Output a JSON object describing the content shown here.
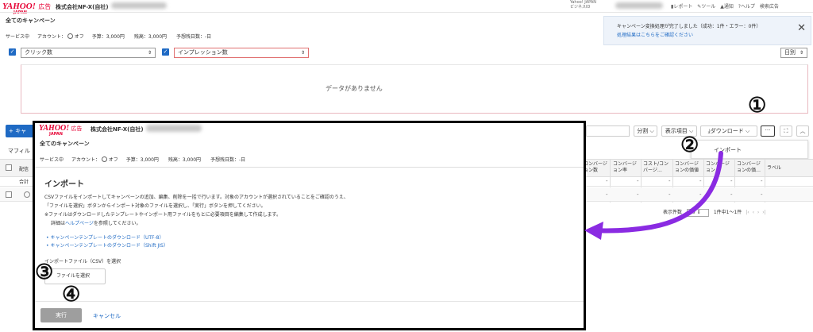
{
  "bg": {
    "logo_main": "YAHOO!",
    "logo_sub": "JAPAN",
    "logo_ad": "広告",
    "company": "株式会社NF-X(自社)",
    "yahoo_id_line1": "Yahoo! JAPAN",
    "yahoo_id_line2": "ビジネスID",
    "header_links": [
      "レポート",
      "ツール",
      "通知",
      "ヘルプ",
      "検索広告"
    ],
    "page_title": "全てのキャンペーン",
    "status_line": {
      "service": "サービス中",
      "account_label": "アカウント：",
      "account_value": "オフ",
      "budget": "予算：3,000円",
      "balance": "残高：3,000円",
      "days": "予想残日数：-日"
    },
    "notification": {
      "line1": "キャンペーン変換処理が完了しました（成功：1件・エラー：0件）",
      "line2": "処理結果はこちらをご確認ください"
    },
    "metric_select_1": "クリック数",
    "metric_select_2": "インプレッション数",
    "period_select": "日別",
    "no_data": "データがありません",
    "toolbar": {
      "add_button": "+ キャ",
      "split": "分割",
      "display_items": "表示項目",
      "download": "ダウンロード",
      "more": "···"
    },
    "menu_import": "インポート",
    "filter_label": "マフィル",
    "columns": [
      "コンバージョン数",
      "コンバージョン率",
      "コスト/コンバージ…",
      "コンバージョンの価値",
      "コンバージョン…",
      "コンバージョンの価…",
      "ラベル"
    ],
    "row_total_label": "合計",
    "row_setting_label": "配信",
    "dash": "-",
    "pagination": {
      "display_count_label": "表示件数",
      "display_count_value": "20",
      "range": "1件中1～1件"
    }
  },
  "dialog": {
    "logo_main": "YAHOO!",
    "logo_sub": "JAPAN",
    "logo_ad": "広告",
    "company": "株式会社NF-X(自社)",
    "page_title": "全てのキャンペーン",
    "status_line": {
      "service": "サービス中",
      "account_label": "アカウント：",
      "account_value": "オフ",
      "budget": "予算：3,000円",
      "balance": "残高：3,000円",
      "days": "予想残日数：-日"
    },
    "heading": "インポート",
    "desc_line1": "CSVファイルをインポートしてキャンペーンの追加、編集、削除を一括で行います。対象のアカウントが選択されていることをご確認のうえ、",
    "desc_line2": "「ファイルを選択」ボタンからインポート対象のファイルを選択し、「実行」ボタンを押してください。",
    "desc_line3": "※ファイルはダウンロードしたテンプレートやインポート用ファイルをもとに必要項目を編集して作成します。",
    "help_prefix": "詳細は",
    "help_link": "ヘルプページ",
    "help_suffix": "を参照してください。",
    "template_utf8": "キャンペーンテンプレートのダウンロード（UTF-8）",
    "template_sjis": "キャンペーンテンプレートのダウンロード（Shift JIS）",
    "file_label": "インポートファイル（CSV）を選択",
    "file_button": "ファイルを選択",
    "run_button": "実行",
    "cancel_button": "キャンセル"
  },
  "annotations": {
    "step1": "①",
    "step2": "②",
    "step3": "③",
    "step4": "④",
    "arrow_color": "#8a2be2"
  },
  "colors": {
    "accent": "#1f6ac4",
    "brand": "#e60033",
    "run_button_bg": "#9e9e9e",
    "frame": "#000000"
  }
}
